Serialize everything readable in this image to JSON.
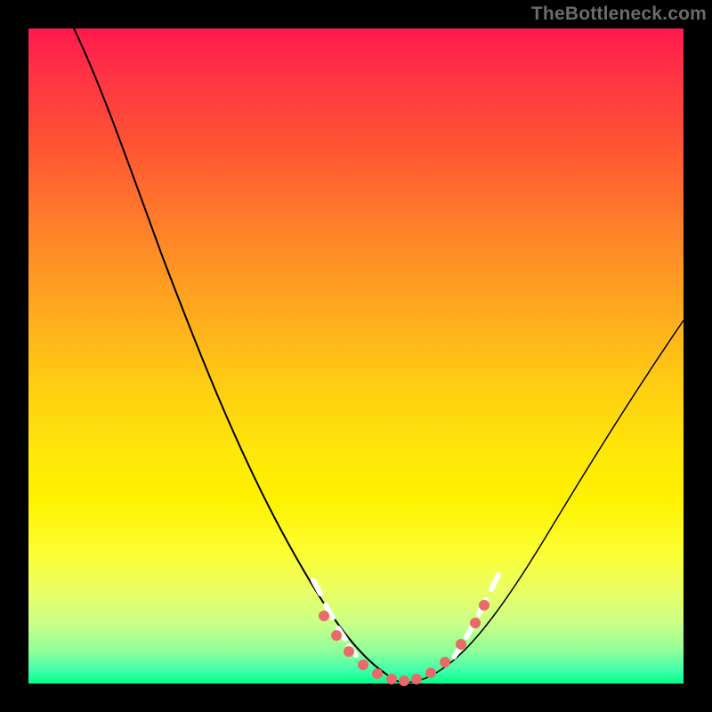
{
  "watermark": "TheBottleneck.com",
  "chart_data": {
    "type": "line",
    "title": "",
    "xlabel": "",
    "ylabel": "",
    "xlim": [
      0,
      100
    ],
    "ylim": [
      0,
      100
    ],
    "grid": false,
    "legend": false,
    "series": [
      {
        "name": "curve-left",
        "x": [
          7,
          12,
          18,
          24,
          30,
          36,
          42,
          47,
          51,
          54,
          56
        ],
        "y": [
          100,
          87,
          72,
          56,
          41,
          27,
          15,
          7,
          3,
          1,
          0
        ]
      },
      {
        "name": "curve-right",
        "x": [
          56,
          60,
          64,
          68,
          73,
          80,
          88,
          96,
          100
        ],
        "y": [
          0,
          1,
          3,
          7,
          14,
          25,
          38,
          50,
          56
        ]
      },
      {
        "name": "bottom-markers",
        "x": [
          45,
          47,
          49,
          51,
          53,
          55,
          57,
          59,
          61,
          63,
          66,
          68,
          69
        ],
        "y": [
          10,
          7,
          5,
          3,
          2,
          1,
          1,
          1,
          2,
          3,
          6,
          10,
          13
        ]
      }
    ],
    "annotations": [
      {
        "type": "dash-highlight",
        "x_range": [
          43,
          49
        ],
        "side": "left",
        "color": "#ffffff"
      },
      {
        "type": "dash-highlight",
        "x_range": [
          65,
          71
        ],
        "side": "right",
        "color": "#ffffff"
      }
    ]
  }
}
